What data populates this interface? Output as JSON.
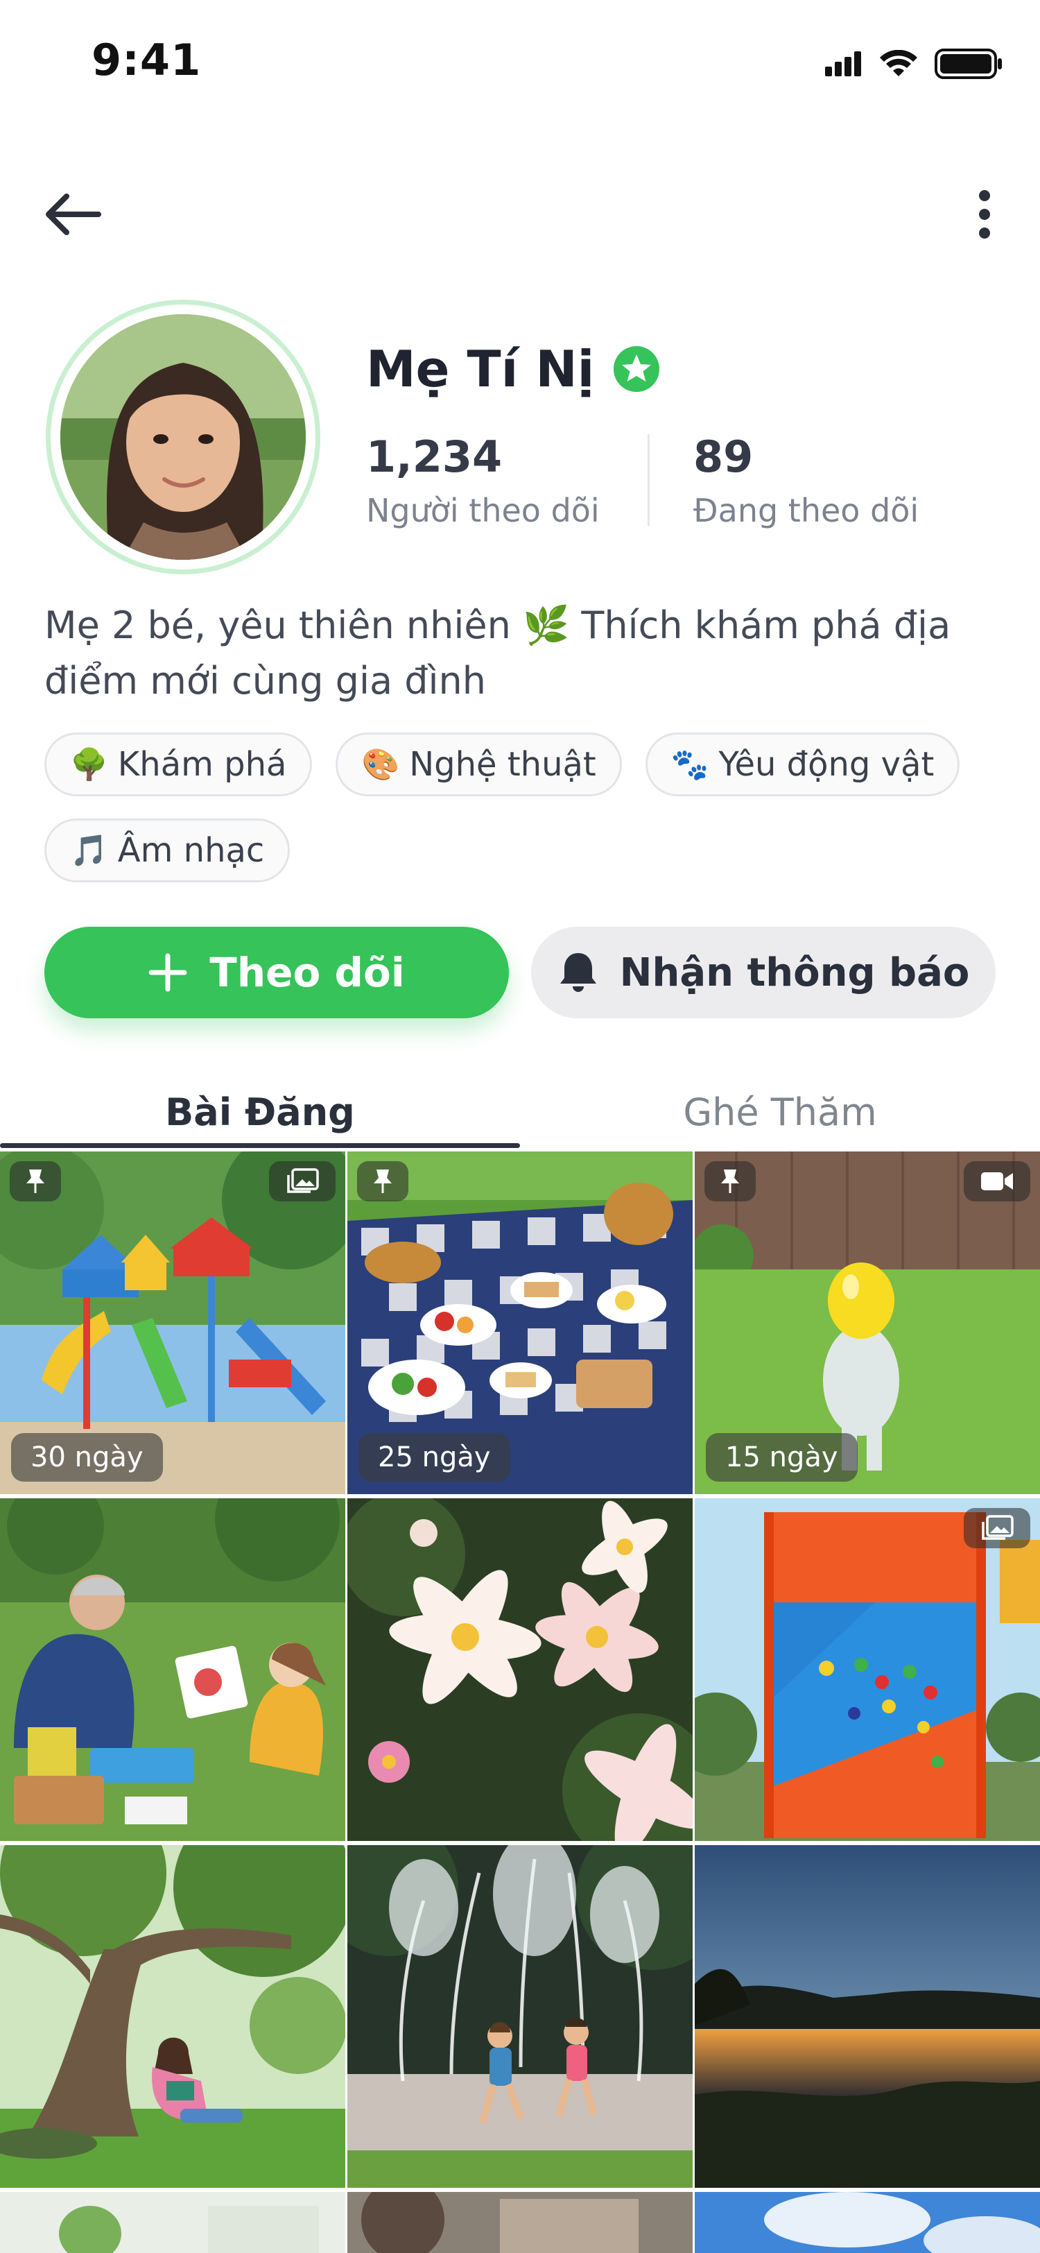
{
  "status_bar": {
    "time": "9:41",
    "icons": [
      "cellular-signal-icon",
      "wifi-icon",
      "battery-icon"
    ]
  },
  "nav": {
    "back_icon": "arrow-left-icon",
    "more_icon": "more-vertical-icon"
  },
  "profile": {
    "name": "Mẹ Tí Nị",
    "verified": true,
    "followers_count": "1,234",
    "followers_label": "Người theo dõi",
    "following_count": "89",
    "following_label": "Đang theo dõi",
    "bio": "Mẹ 2 bé, yêu thiên nhiên 🌿 Thích khám phá địa điểm mới cùng gia đình",
    "interests": [
      {
        "emoji": "🌳",
        "label": "Khám phá"
      },
      {
        "emoji": "🎨",
        "label": "Nghệ thuật"
      },
      {
        "emoji": "🐾",
        "label": "Yêu động vật"
      },
      {
        "emoji": "🎵",
        "label": "Âm nhạc"
      }
    ]
  },
  "actions": {
    "follow_label": "Theo dõi",
    "notify_label": "Nhận thông báo"
  },
  "tabs": [
    {
      "label": "Bài Đăng",
      "active": true
    },
    {
      "label": "Ghé Thăm",
      "active": false
    }
  ],
  "posts": [
    {
      "scene": "playground",
      "pinned": true,
      "type": "gallery",
      "age": "30 ngày"
    },
    {
      "scene": "picnic",
      "pinned": true,
      "type": "",
      "age": "25 ngày"
    },
    {
      "scene": "toddler-balloon",
      "pinned": true,
      "type": "video",
      "age": "15 ngày"
    },
    {
      "scene": "family-painting",
      "pinned": false,
      "type": "",
      "age": ""
    },
    {
      "scene": "lilies",
      "pinned": false,
      "type": "",
      "age": ""
    },
    {
      "scene": "climbing-wall",
      "pinned": false,
      "type": "gallery",
      "age": ""
    },
    {
      "scene": "girl-under-tree",
      "pinned": false,
      "type": "",
      "age": ""
    },
    {
      "scene": "fountain-kids",
      "pinned": false,
      "type": "",
      "age": ""
    },
    {
      "scene": "sunset-lake",
      "pinned": false,
      "type": "",
      "age": ""
    }
  ],
  "colors": {
    "accent": "#35c35a",
    "text": "#1f2430",
    "muted": "#7c828f"
  }
}
